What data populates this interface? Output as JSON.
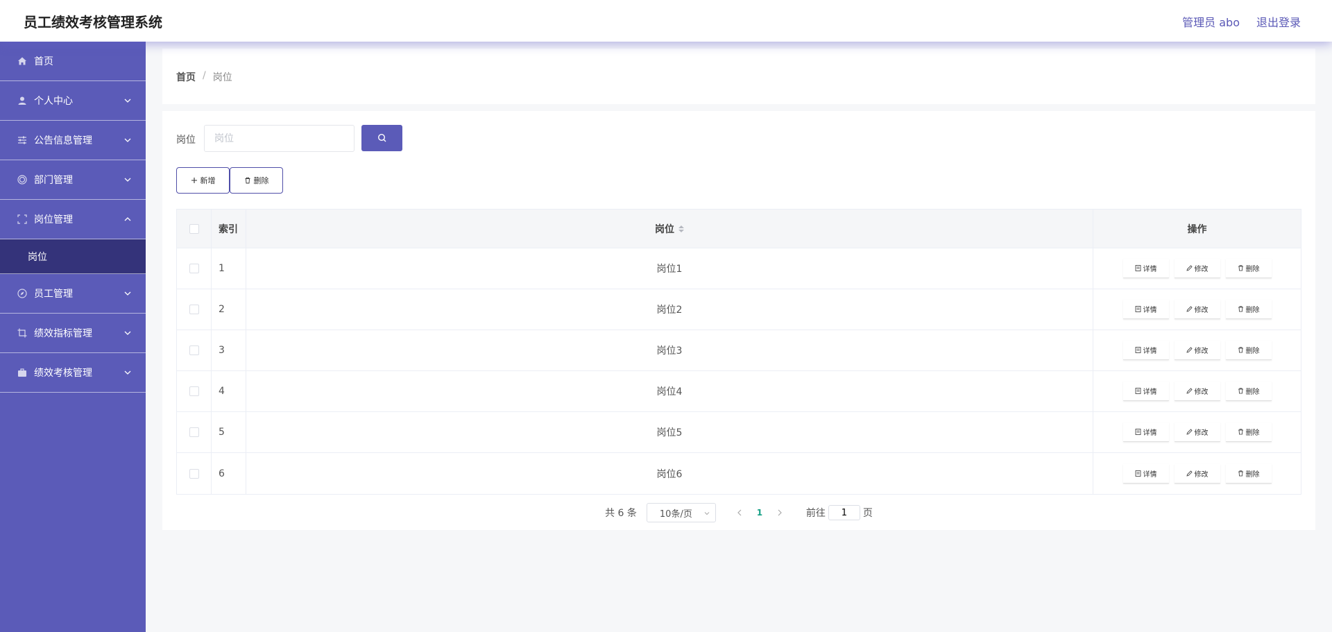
{
  "app": {
    "title": "员工绩效考核管理系统"
  },
  "header": {
    "user": "管理员 abo",
    "logout": "退出登录"
  },
  "sidebar": {
    "items": [
      {
        "label": "首页",
        "icon": "home-icon"
      },
      {
        "label": "个人中心",
        "icon": "user-icon"
      },
      {
        "label": "公告信息管理",
        "icon": "sliders-icon"
      },
      {
        "label": "部门管理",
        "icon": "target-icon"
      },
      {
        "label": "岗位管理",
        "icon": "frame-icon",
        "expanded": true,
        "sub": "岗位"
      },
      {
        "label": "员工管理",
        "icon": "compass-icon"
      },
      {
        "label": "绩效指标管理",
        "icon": "crop-icon"
      },
      {
        "label": "绩效考核管理",
        "icon": "briefcase-icon"
      }
    ]
  },
  "breadcrumb": {
    "home": "首页",
    "sep": "/",
    "current": "岗位"
  },
  "search": {
    "label": "岗位",
    "placeholder": "岗位",
    "value": ""
  },
  "toolbar": {
    "add_label": "新增",
    "delete_label": "删除"
  },
  "table": {
    "headers": {
      "index": "索引",
      "position": "岗位",
      "ops": "操作"
    },
    "ops": {
      "detail": "详情",
      "edit": "修改",
      "delete": "删除"
    },
    "rows": [
      {
        "index": "1",
        "position": "岗位1"
      },
      {
        "index": "2",
        "position": "岗位2"
      },
      {
        "index": "3",
        "position": "岗位3"
      },
      {
        "index": "4",
        "position": "岗位4"
      },
      {
        "index": "5",
        "position": "岗位5"
      },
      {
        "index": "6",
        "position": "岗位6"
      }
    ]
  },
  "pagination": {
    "total": "共 6 条",
    "page_size": "10条/页",
    "current_page": "1",
    "goto_label": "前往",
    "goto_value": "1",
    "page_unit": "页"
  },
  "colors": {
    "accent": "#5b5bb8",
    "submenu_active": "#34337a",
    "page_active": "#16a085"
  }
}
